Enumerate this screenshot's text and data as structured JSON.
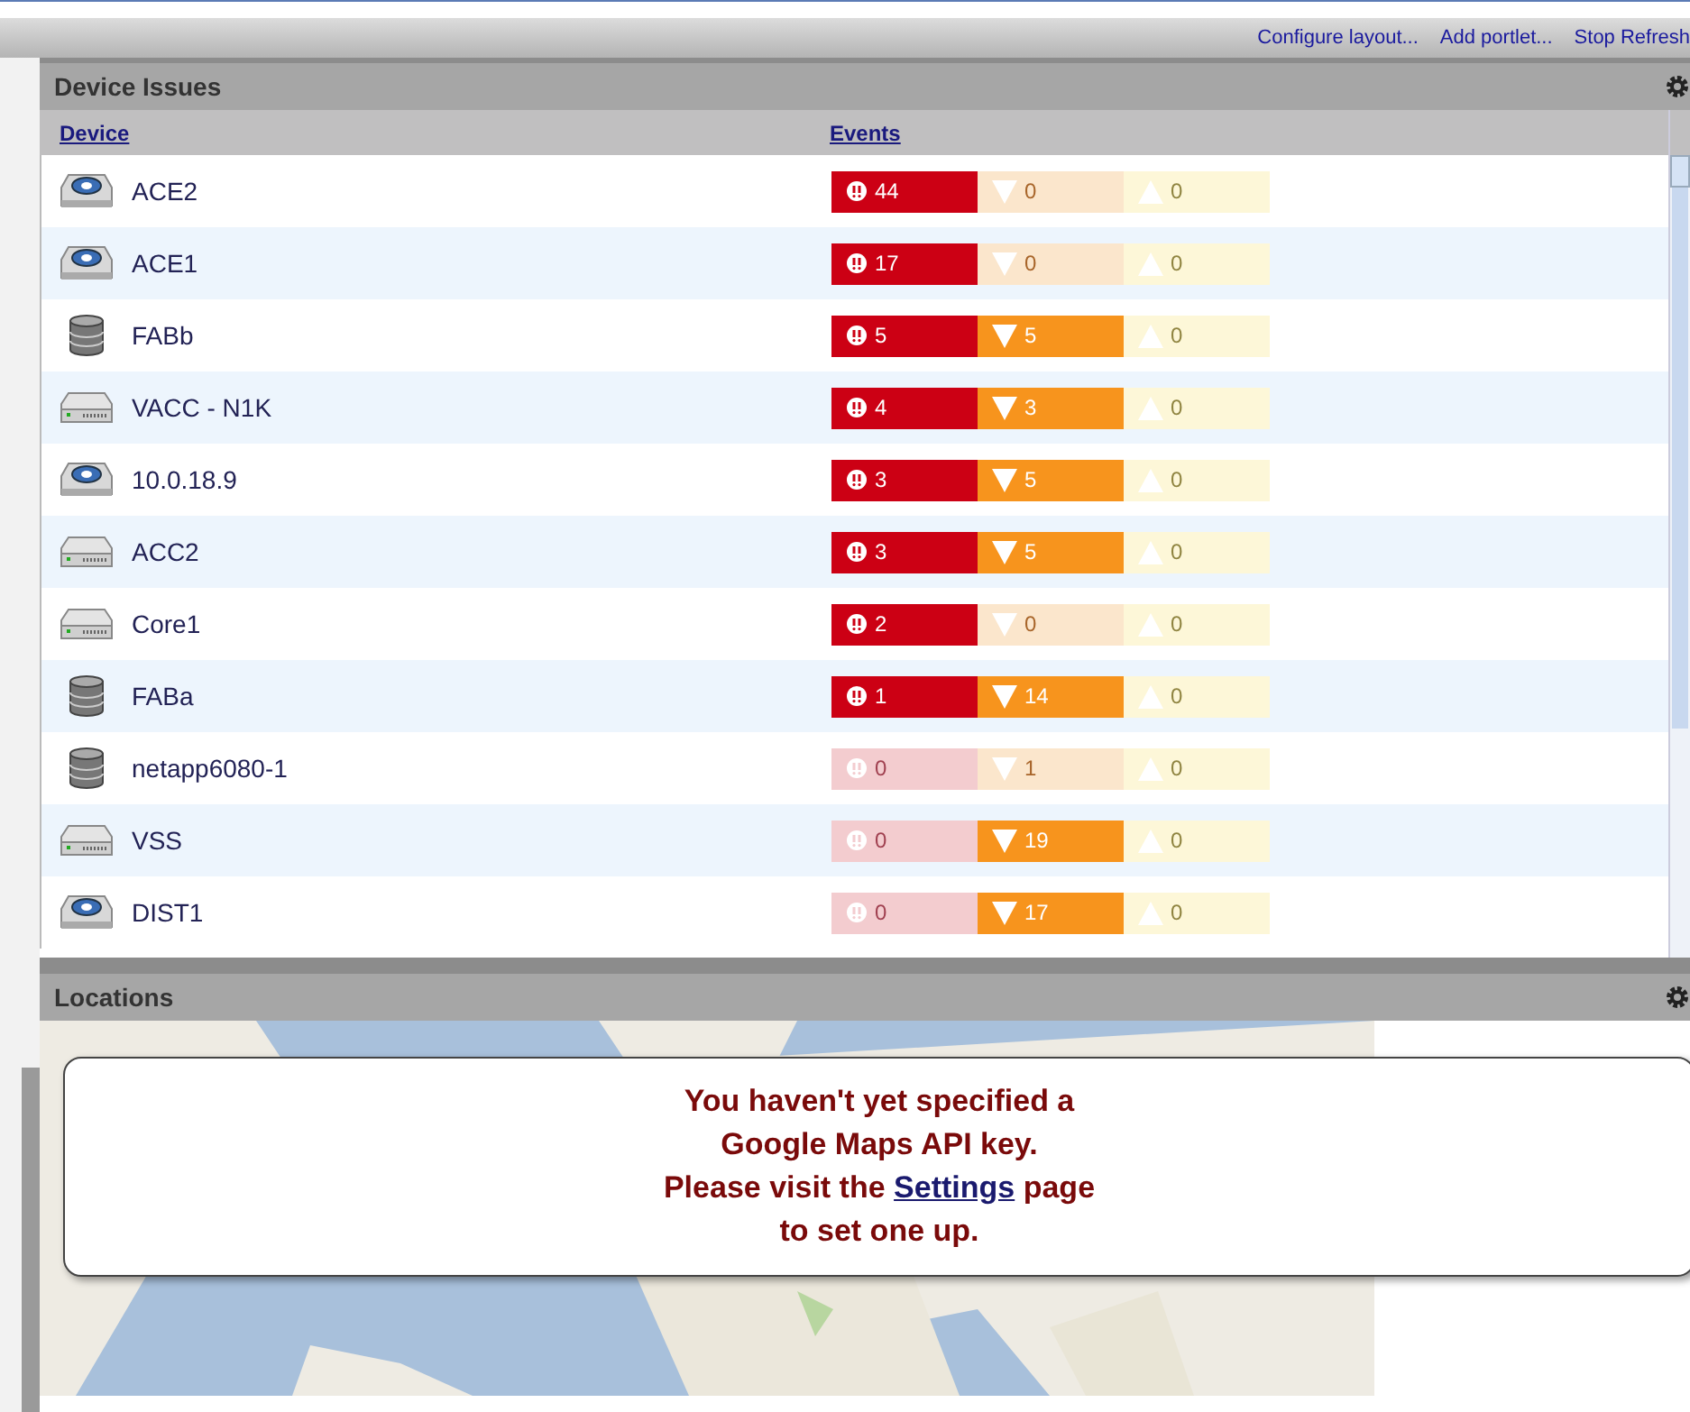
{
  "toolbar": {
    "links": [
      "Configure layout...",
      "Add portlet...",
      "Stop Refresh"
    ]
  },
  "device_issues": {
    "title": "Device Issues",
    "columns": [
      "Device",
      "Events"
    ],
    "rows": [
      {
        "device": "ACE2",
        "kind": "unknown",
        "critical": "44",
        "major": "0",
        "minor": "0",
        "critical_active": true,
        "major_active": false,
        "minor_active": false
      },
      {
        "device": "ACE1",
        "kind": "unknown",
        "critical": "17",
        "major": "0",
        "minor": "0",
        "critical_active": true,
        "major_active": false,
        "minor_active": false
      },
      {
        "device": "FABb",
        "kind": "storage",
        "critical": "5",
        "major": "5",
        "minor": "0",
        "critical_active": true,
        "major_active": true,
        "minor_active": false
      },
      {
        "device": "VACC - N1K",
        "kind": "switch",
        "critical": "4",
        "major": "3",
        "minor": "0",
        "critical_active": true,
        "major_active": true,
        "minor_active": false
      },
      {
        "device": "10.0.18.9",
        "kind": "unknown",
        "critical": "3",
        "major": "5",
        "minor": "0",
        "critical_active": true,
        "major_active": true,
        "minor_active": false
      },
      {
        "device": "ACC2",
        "kind": "switch",
        "critical": "3",
        "major": "5",
        "minor": "0",
        "critical_active": true,
        "major_active": true,
        "minor_active": false
      },
      {
        "device": "Core1",
        "kind": "switch",
        "critical": "2",
        "major": "0",
        "minor": "0",
        "critical_active": true,
        "major_active": false,
        "minor_active": false
      },
      {
        "device": "FABa",
        "kind": "storage",
        "critical": "1",
        "major": "14",
        "minor": "0",
        "critical_active": true,
        "major_active": true,
        "minor_active": false
      },
      {
        "device": "netapp6080-1",
        "kind": "storage",
        "critical": "0",
        "major": "1",
        "minor": "0",
        "critical_active": false,
        "major_active": false,
        "minor_active": false
      },
      {
        "device": "VSS",
        "kind": "switch",
        "critical": "0",
        "major": "19",
        "minor": "0",
        "critical_active": false,
        "major_active": true,
        "minor_active": false
      },
      {
        "device": "DIST1",
        "kind": "unknown",
        "critical": "0",
        "major": "17",
        "minor": "0",
        "critical_active": false,
        "major_active": true,
        "minor_active": false
      }
    ]
  },
  "locations": {
    "title": "Locations",
    "message_lines": [
      "You haven't yet specified a",
      "Google Maps API key.",
      "Please visit the",
      "page",
      "to set one up."
    ],
    "settings_link": "Settings"
  }
}
